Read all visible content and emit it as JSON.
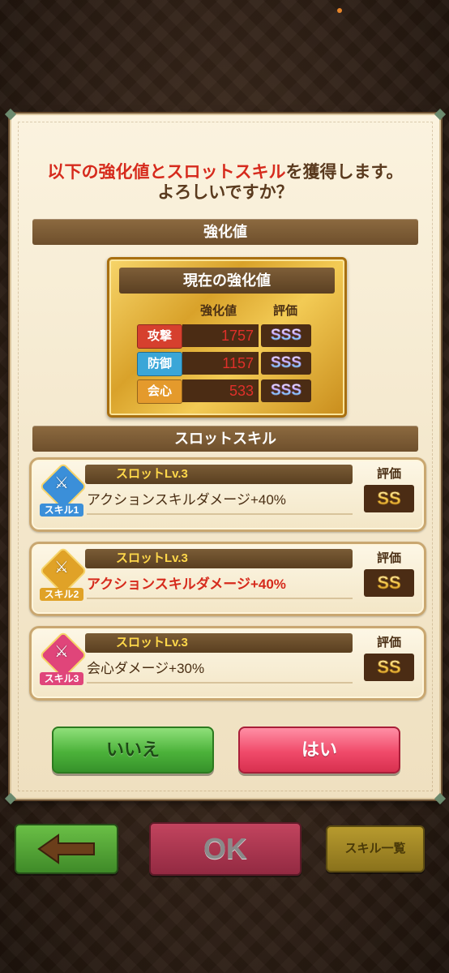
{
  "status_bar": {
    "notification_dot_color": "#e8862a"
  },
  "dialog": {
    "prompt_highlight": "以下の強化値とスロットスキル",
    "prompt_rest_line1": "を獲得します。",
    "prompt_line2": "よろしいですか？",
    "enhance_section_title": "強化値",
    "current_values_title": "現在の強化値",
    "col_value": "強化値",
    "col_grade": "評価",
    "stats": [
      {
        "label": "攻撃",
        "value": "1757",
        "grade": "SSS",
        "color": "#d6402e"
      },
      {
        "label": "防御",
        "value": "1157",
        "grade": "SSS",
        "color": "#3aa6d8"
      },
      {
        "label": "会心",
        "value": "533",
        "grade": "SSS",
        "color": "#e49a2c"
      }
    ],
    "slot_section_title": "スロットスキル",
    "skills": [
      {
        "tag": "スキル1",
        "level": "スロットLv.3",
        "text": "アクションスキルダメージ+40%",
        "grade_label": "評価",
        "grade": "SS",
        "icon": "sword-blue-icon",
        "color": "#3b8fd9"
      },
      {
        "tag": "スキル2",
        "level": "スロットLv.3",
        "text": "アクションスキルダメージ+40%",
        "grade_label": "評価",
        "grade": "SS",
        "icon": "sword-gold-icon",
        "color": "#e0a227"
      },
      {
        "tag": "スキル3",
        "level": "スロットLv.3",
        "text": "会心ダメージ+30%",
        "grade_label": "評価",
        "grade": "SS",
        "icon": "sword-pink-icon",
        "color": "#e0457a"
      }
    ],
    "no_label": "いいえ",
    "yes_label": "はい"
  },
  "bottom_bar": {
    "back_icon": "back-arrow-icon",
    "ok_label": "OK",
    "skill_list_label": "スキル一覧"
  }
}
